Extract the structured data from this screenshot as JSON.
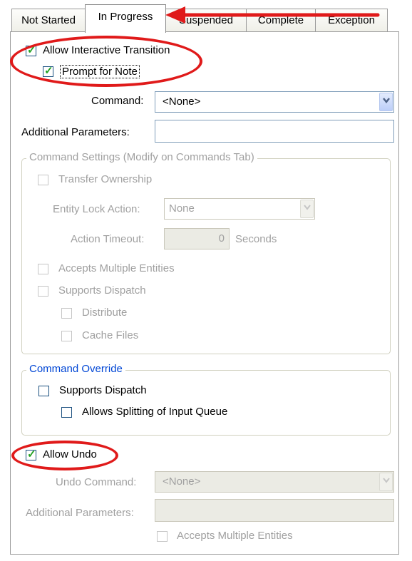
{
  "tabs": [
    "Not Started",
    "In Progress",
    "Suspended",
    "Complete",
    "Exception"
  ],
  "active_tab": 1,
  "main": {
    "allow_interactive_transition": "Allow Interactive Transition",
    "prompt_for_note": "Prompt for Note",
    "command_label": "Command:",
    "command_value": "<None>",
    "additional_parameters_label": "Additional Parameters:",
    "additional_parameters_value": ""
  },
  "command_settings": {
    "title": "Command Settings (Modify on Commands Tab)",
    "transfer_ownership": "Transfer Ownership",
    "entity_lock_action_label": "Entity Lock Action:",
    "entity_lock_action_value": "None",
    "action_timeout_label": "Action Timeout:",
    "action_timeout_value": "0",
    "action_timeout_unit": "Seconds",
    "accepts_multiple_entities": "Accepts Multiple Entities",
    "supports_dispatch": "Supports Dispatch",
    "distribute": "Distribute",
    "cache_files": "Cache Files"
  },
  "command_override": {
    "title": "Command Override",
    "supports_dispatch": "Supports Dispatch",
    "allows_splitting": "Allows Splitting of Input Queue"
  },
  "undo": {
    "allow_undo": "Allow Undo",
    "undo_command_label": "Undo Command:",
    "undo_command_value": "<None>",
    "additional_parameters_label": "Additional Parameters:",
    "additional_parameters_value": "",
    "accepts_multiple_entities": "Accepts Multiple Entities"
  },
  "checked_states": {
    "allow_interactive_transition": true,
    "prompt_for_note": true,
    "transfer_ownership": false,
    "accepts_multiple_entities": false,
    "supports_dispatch": false,
    "distribute": false,
    "cache_files": false,
    "override_supports_dispatch": false,
    "allows_splitting": false,
    "allow_undo": true,
    "undo_accepts_multiple_entities": false
  },
  "colors": {
    "annotation": "#e01a1a",
    "group_title_blue": "#0046d5",
    "checkmark": "#21a121",
    "disabled_text": "#a0a0a0"
  }
}
